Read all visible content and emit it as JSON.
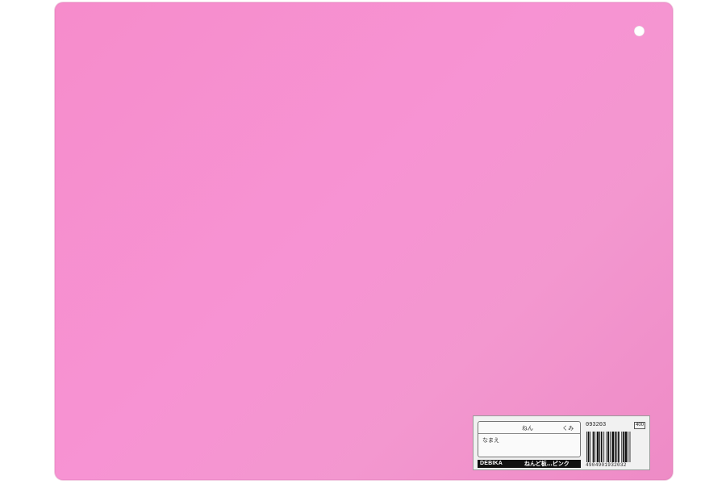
{
  "product": {
    "board_color": "#f793d3",
    "sticker": {
      "grade_label": "ねん",
      "class_label": "くみ",
      "name_label": "なまえ",
      "brand": "DEBIKA",
      "product_name": "ねんど板…ピンク",
      "product_code": "093203",
      "price": "400",
      "barcode_number": "4904901932032"
    }
  }
}
